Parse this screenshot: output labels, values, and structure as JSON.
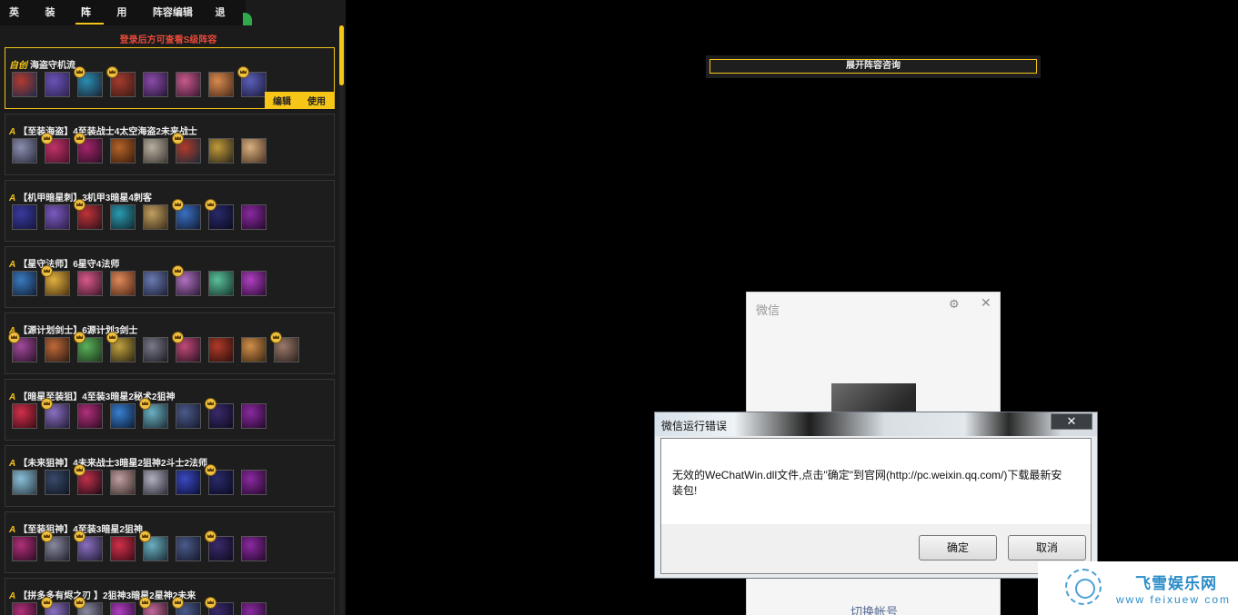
{
  "nav": {
    "tabs": [
      "英雄",
      "装备",
      "阵容",
      "用户",
      "阵容编辑器",
      "退出"
    ],
    "active_index": 2
  },
  "list": {
    "login_hint": "登录后方可查看S级阵容",
    "cards": [
      {
        "tier": "自创",
        "title": "海盗守机流",
        "selected": true,
        "actions": [
          "编辑",
          "使用"
        ],
        "champions": [
          {
            "colors": [
              "#b33a2f",
              "#1b2a4a"
            ],
            "crown": false
          },
          {
            "colors": [
              "#6a52b8",
              "#2d234d"
            ],
            "crown": false
          },
          {
            "colors": [
              "#2b8db3",
              "#1a2230"
            ],
            "crown": true
          },
          {
            "colors": [
              "#a33b2e",
              "#3a1a14"
            ],
            "crown": true
          },
          {
            "colors": [
              "#8b4aa8",
              "#241534"
            ],
            "crown": false
          },
          {
            "colors": [
              "#c65a8b",
              "#3a1630"
            ],
            "crown": false
          },
          {
            "colors": [
              "#d98a4f",
              "#4a2a18"
            ],
            "crown": false
          },
          {
            "colors": [
              "#5b5fb8",
              "#1a1a3a"
            ],
            "crown": true
          }
        ]
      },
      {
        "tier": "A",
        "title": "【至装海盗】4至装战士4太空海盗2未来战士",
        "selected": false,
        "actions": [],
        "champions": [
          {
            "colors": [
              "#8a8fb0",
              "#2a2a3a"
            ],
            "crown": false
          },
          {
            "colors": [
              "#c0336a",
              "#4a1028"
            ],
            "crown": true
          },
          {
            "colors": [
              "#a3246a",
              "#2a0f24"
            ],
            "crown": true
          },
          {
            "colors": [
              "#b3642a",
              "#3a1a0a"
            ],
            "crown": false
          },
          {
            "colors": [
              "#b8b0a0",
              "#3a3530"
            ],
            "crown": false
          },
          {
            "colors": [
              "#b03a2a",
              "#1a2a3a"
            ],
            "crown": true
          },
          {
            "colors": [
              "#c09a3a",
              "#2a2418"
            ],
            "crown": false
          },
          {
            "colors": [
              "#d8b080",
              "#4a3020"
            ],
            "crown": false
          }
        ]
      },
      {
        "tier": "A",
        "title": "【机甲暗星刺】3机甲3暗星4刺客",
        "selected": false,
        "actions": [],
        "champions": [
          {
            "colors": [
              "#3a3aa0",
              "#141438"
            ],
            "crown": false
          },
          {
            "colors": [
              "#7a5ac0",
              "#2a1d44"
            ],
            "crown": false
          },
          {
            "colors": [
              "#c0333a",
              "#2a1018"
            ],
            "crown": true
          },
          {
            "colors": [
              "#2a9ab0",
              "#10262e"
            ],
            "crown": false
          },
          {
            "colors": [
              "#c0a060",
              "#3a2a18"
            ],
            "crown": false
          },
          {
            "colors": [
              "#3a70c0",
              "#101a34"
            ],
            "crown": true
          },
          {
            "colors": [
              "#2a2a6a",
              "#0a0a20"
            ],
            "crown": true
          },
          {
            "colors": [
              "#8a2aa0",
              "#24082a"
            ],
            "crown": false
          }
        ]
      },
      {
        "tier": "A",
        "title": "【星守法师】6星守4法师",
        "selected": false,
        "actions": [],
        "champions": [
          {
            "colors": [
              "#3a7ac0",
              "#101e34"
            ],
            "crown": false
          },
          {
            "colors": [
              "#e0b040",
              "#4a3010"
            ],
            "crown": true
          },
          {
            "colors": [
              "#d85a8a",
              "#3a1428"
            ],
            "crown": false
          },
          {
            "colors": [
              "#e08a5a",
              "#4a2414"
            ],
            "crown": false
          },
          {
            "colors": [
              "#6a7ab0",
              "#1a1e34"
            ],
            "crown": false
          },
          {
            "colors": [
              "#b070c0",
              "#2a1834"
            ],
            "crown": true
          },
          {
            "colors": [
              "#5ac09a",
              "#14342a"
            ],
            "crown": false
          },
          {
            "colors": [
              "#b040c0",
              "#2a0a34"
            ],
            "crown": false
          }
        ]
      },
      {
        "tier": "A",
        "title": "【源计划剑士】6源计划3剑士",
        "selected": false,
        "actions": [],
        "champions": [
          {
            "colors": [
              "#a04a9a",
              "#2a1028"
            ],
            "crown": true
          },
          {
            "colors": [
              "#c06a3a",
              "#2a1a10"
            ],
            "crown": false
          },
          {
            "colors": [
              "#5ab05a",
              "#1a341a"
            ],
            "crown": true
          },
          {
            "colors": [
              "#c0a040",
              "#2a2410"
            ],
            "crown": true
          },
          {
            "colors": [
              "#7a7a8a",
              "#1a1a22"
            ],
            "crown": false
          },
          {
            "colors": [
              "#c04a7a",
              "#2a1020"
            ],
            "crown": true
          },
          {
            "colors": [
              "#b03a2a",
              "#2a0e0a"
            ],
            "crown": false
          },
          {
            "colors": [
              "#d0904a",
              "#3a2410"
            ],
            "crown": false
          },
          {
            "colors": [
              "#9a7a6a",
              "#2a1e1a"
            ],
            "crown": true
          }
        ]
      },
      {
        "tier": "A",
        "title": "【暗星至装狙】4至装3暗星2秘术2狙神",
        "selected": false,
        "actions": [],
        "champions": [
          {
            "colors": [
              "#d0304a",
              "#3a0a14"
            ],
            "crown": false
          },
          {
            "colors": [
              "#8a70c0",
              "#201a34"
            ],
            "crown": true
          },
          {
            "colors": [
              "#b0307a",
              "#2a0a20"
            ],
            "crown": false
          },
          {
            "colors": [
              "#3a80d0",
              "#0a1a34"
            ],
            "crown": false
          },
          {
            "colors": [
              "#6ab0c0",
              "#1a2a34"
            ],
            "crown": true
          },
          {
            "colors": [
              "#4a5a8a",
              "#14182a"
            ],
            "crown": false
          },
          {
            "colors": [
              "#3a2a6a",
              "#0e0a20"
            ],
            "crown": true
          },
          {
            "colors": [
              "#8a2aa0",
              "#24082a"
            ],
            "crown": false
          }
        ]
      },
      {
        "tier": "A",
        "title": "【未来狙神】4未来战士3暗星2狙神2斗士2法师",
        "selected": false,
        "actions": [],
        "champions": [
          {
            "colors": [
              "#8ac0d8",
              "#2a3a44"
            ],
            "crown": false
          },
          {
            "colors": [
              "#3a4a6a",
              "#0e1420"
            ],
            "crown": false
          },
          {
            "colors": [
              "#c0304a",
              "#1a0a14"
            ],
            "crown": true
          },
          {
            "colors": [
              "#c0a0a0",
              "#3a2a2a"
            ],
            "crown": false
          },
          {
            "colors": [
              "#b0b0c0",
              "#2a2a34"
            ],
            "crown": false
          },
          {
            "colors": [
              "#3a4ac0",
              "#0a0e34"
            ],
            "crown": false
          },
          {
            "colors": [
              "#2a2a6a",
              "#0a0a20"
            ],
            "crown": true
          },
          {
            "colors": [
              "#8a2aa0",
              "#24082a"
            ],
            "crown": false
          }
        ]
      },
      {
        "tier": "A",
        "title": "【至装狙神】4至装3暗星2狙神",
        "selected": false,
        "actions": [],
        "champions": [
          {
            "colors": [
              "#b0307a",
              "#2a0a20"
            ],
            "crown": false
          },
          {
            "colors": [
              "#8a8aa0",
              "#1e1e2a"
            ],
            "crown": true
          },
          {
            "colors": [
              "#8a70c0",
              "#201a34"
            ],
            "crown": true
          },
          {
            "colors": [
              "#d0304a",
              "#3a0a14"
            ],
            "crown": false
          },
          {
            "colors": [
              "#6ab0c0",
              "#1a2a34"
            ],
            "crown": true
          },
          {
            "colors": [
              "#4a5a8a",
              "#14182a"
            ],
            "crown": false
          },
          {
            "colors": [
              "#3a2a6a",
              "#0e0a20"
            ],
            "crown": true
          },
          {
            "colors": [
              "#8a2aa0",
              "#24082a"
            ],
            "crown": false
          }
        ]
      },
      {
        "tier": "A",
        "title": "【拼多多有烬之刃 】2狙神3暗星2星神2未来",
        "selected": false,
        "actions": [],
        "champions": [
          {
            "colors": [
              "#b0307a",
              "#2a0a20"
            ],
            "crown": false
          },
          {
            "colors": [
              "#8a70c0",
              "#201a34"
            ],
            "crown": true
          },
          {
            "colors": [
              "#8a8aa0",
              "#1e1e2a"
            ],
            "crown": true
          },
          {
            "colors": [
              "#b040c0",
              "#2a0a34"
            ],
            "crown": false
          },
          {
            "colors": [
              "#c06a9a",
              "#2a1020"
            ],
            "crown": true
          },
          {
            "colors": [
              "#4a5a8a",
              "#14182a"
            ],
            "crown": true
          },
          {
            "colors": [
              "#3a2a6a",
              "#0e0a20"
            ],
            "crown": true
          },
          {
            "colors": [
              "#8a2aa0",
              "#24082a"
            ],
            "crown": false
          }
        ]
      }
    ]
  },
  "expand_button": "展开阵容咨询",
  "wechat": {
    "title": "微信",
    "switch_account": "切换帐号"
  },
  "error_dialog": {
    "title": "微信运行错误",
    "message": "无效的WeChatWin.dll文件,点击\"确定\"到官网(http://pc.weixin.qq.com/)下载最新安装包!",
    "ok_label": "确定",
    "cancel_label": "取消",
    "close_label": "✕"
  },
  "watermark": {
    "name": "飞雪娱乐网",
    "url": "www feixuew com"
  }
}
